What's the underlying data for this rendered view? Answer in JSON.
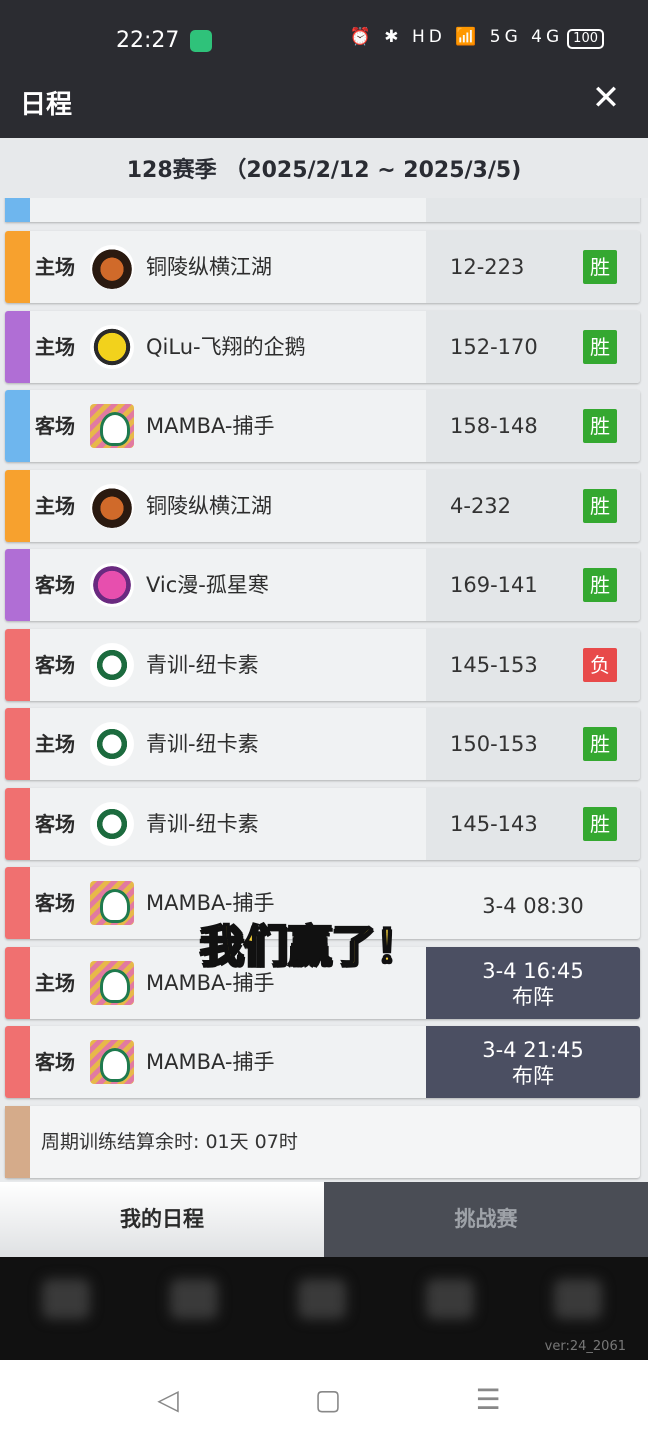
{
  "status_bar": {
    "time": "22:27",
    "icons": "⏰ ✱ HD 📶 5G 4G",
    "battery": "100"
  },
  "header": {
    "title": "日程",
    "close_label": "✕"
  },
  "season": "128赛季 （2025/2/12 ~ 2025/3/5)",
  "colors": {
    "win": "#34a830",
    "loss": "#e84a4a",
    "deploy": "#4b4f62"
  },
  "matches": [
    {
      "venue": "主场",
      "team": "铜陵纵横江湖",
      "logo": "tiger-logo-icon",
      "bar": "orange",
      "score": "12-223",
      "result": "胜"
    },
    {
      "venue": "主场",
      "team": "QiLu-飞翔的企鹅",
      "logo": "duck-logo-icon",
      "bar": "purple",
      "score": "152-170",
      "result": "胜"
    },
    {
      "venue": "客场",
      "team": "MAMBA-捕手",
      "logo": "elephant-logo-icon",
      "bar": "blue",
      "score": "158-148",
      "result": "胜"
    },
    {
      "venue": "主场",
      "team": "铜陵纵横江湖",
      "logo": "tiger-logo-icon",
      "bar": "orange",
      "score": "4-232",
      "result": "胜"
    },
    {
      "venue": "客场",
      "team": "Vic漫-孤星寒",
      "logo": "wolf-logo-icon",
      "bar": "purple",
      "score": "169-141",
      "result": "胜"
    },
    {
      "venue": "客场",
      "team": "青训-纽卡素",
      "logo": "dragon-logo-icon",
      "bar": "red",
      "score": "145-153",
      "result": "负"
    },
    {
      "venue": "主场",
      "team": "青训-纽卡素",
      "logo": "dragon-logo-icon",
      "bar": "red",
      "score": "150-153",
      "result": "胜"
    },
    {
      "venue": "客场",
      "team": "青训-纽卡素",
      "logo": "dragon-logo-icon",
      "bar": "red",
      "score": "145-143",
      "result": "胜"
    }
  ],
  "upcoming": [
    {
      "venue": "客场",
      "team": "MAMBA-捕手",
      "time": "3-4 08:30"
    },
    {
      "venue": "主场",
      "team": "MAMBA-捕手",
      "time": "3-4 16:45",
      "action": "布阵"
    },
    {
      "venue": "客场",
      "team": "MAMBA-捕手",
      "time": "3-4 21:45",
      "action": "布阵"
    }
  ],
  "footer_text": "周期训练结算余时: 01天 07时",
  "overlay_text": "我们赢了！",
  "tabs": {
    "my_schedule": "我的日程",
    "challenge": "挑战赛"
  },
  "version": "ver:24_2061",
  "system_nav": {
    "back": "◁",
    "home": "▢",
    "menu": "☰"
  }
}
